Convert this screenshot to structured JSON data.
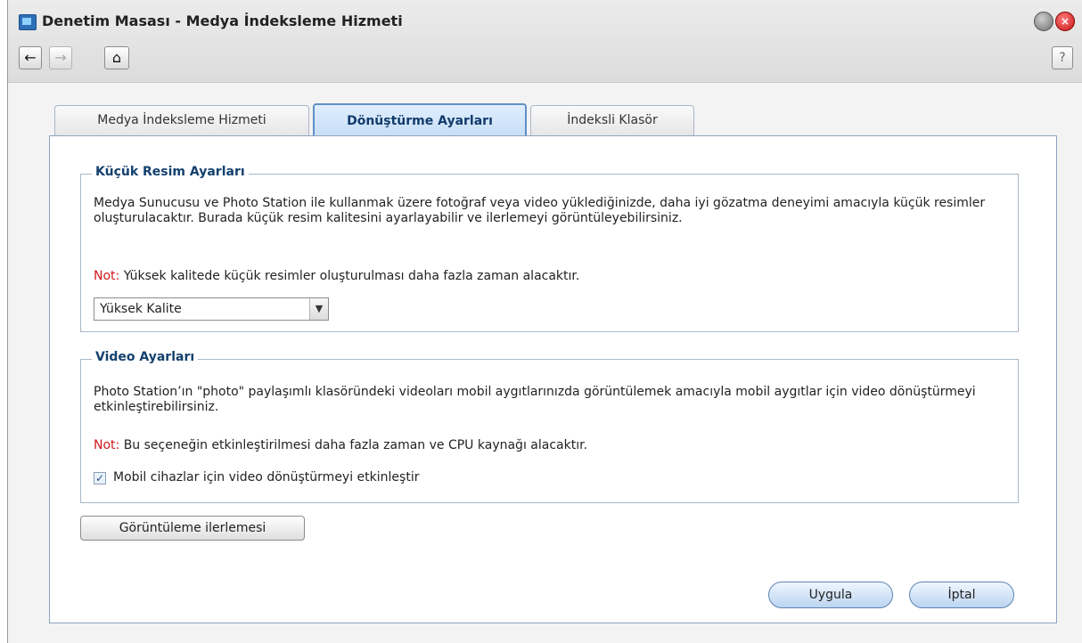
{
  "window": {
    "title": "Denetim Masası - Medya İndeksleme Hizmeti",
    "app_icon": "control-panel-icon",
    "minimize_icon": "minimize-icon",
    "close_icon": "close-icon"
  },
  "toolbar": {
    "back_icon": "←",
    "forward_icon": "→",
    "home_icon": "⌂",
    "help_label": "?"
  },
  "tabs": [
    {
      "label": "Medya İndeksleme Hizmeti",
      "active": false
    },
    {
      "label": "Dönüştürme Ayarları",
      "active": true
    },
    {
      "label": "İndeksli Klasör",
      "active": false
    }
  ],
  "thumbnail_settings": {
    "legend": "Küçük Resim Ayarları",
    "description": "Medya Sunucusu ve Photo Station ile kullanmak üzere fotoğraf veya video yüklediğinizde, daha iyi gözatma deneyimi amacıyla küçük resimler oluşturulacaktır. Burada küçük resim kalitesini ayarlayabilir ve ilerlemeyi görüntüleyebilirsiniz.",
    "note_label": "Not:",
    "note_text": " Yüksek kalitede küçük resimler oluşturulması daha fazla zaman alacaktır.",
    "quality_selected": "Yüksek Kalite"
  },
  "video_settings": {
    "legend": "Video Ayarları",
    "description": "Photo Station’ın \"photo\" paylaşımlı klasöründeki videoları mobil aygıtlarınızda görüntülemek amacıyla mobil aygıtlar için video dönüştürmeyi etkinleştirebilirsiniz.",
    "note_label": "Not:",
    "note_text": " Bu seçeneğin etkinleştirilmesi daha fazla zaman ve CPU kaynağı alacaktır.",
    "checkbox_label": "Mobil cihazlar için video dönüştürmeyi etkinleştir",
    "checkbox_checked": true,
    "checkbox_mark": "✓"
  },
  "buttons": {
    "progress": "Görüntüleme ilerlemesi",
    "apply": "Uygula",
    "cancel": "İptal"
  },
  "colors": {
    "note_red": "#d0191b",
    "legend_blue": "#13406d",
    "active_tab": "#c7def6"
  }
}
